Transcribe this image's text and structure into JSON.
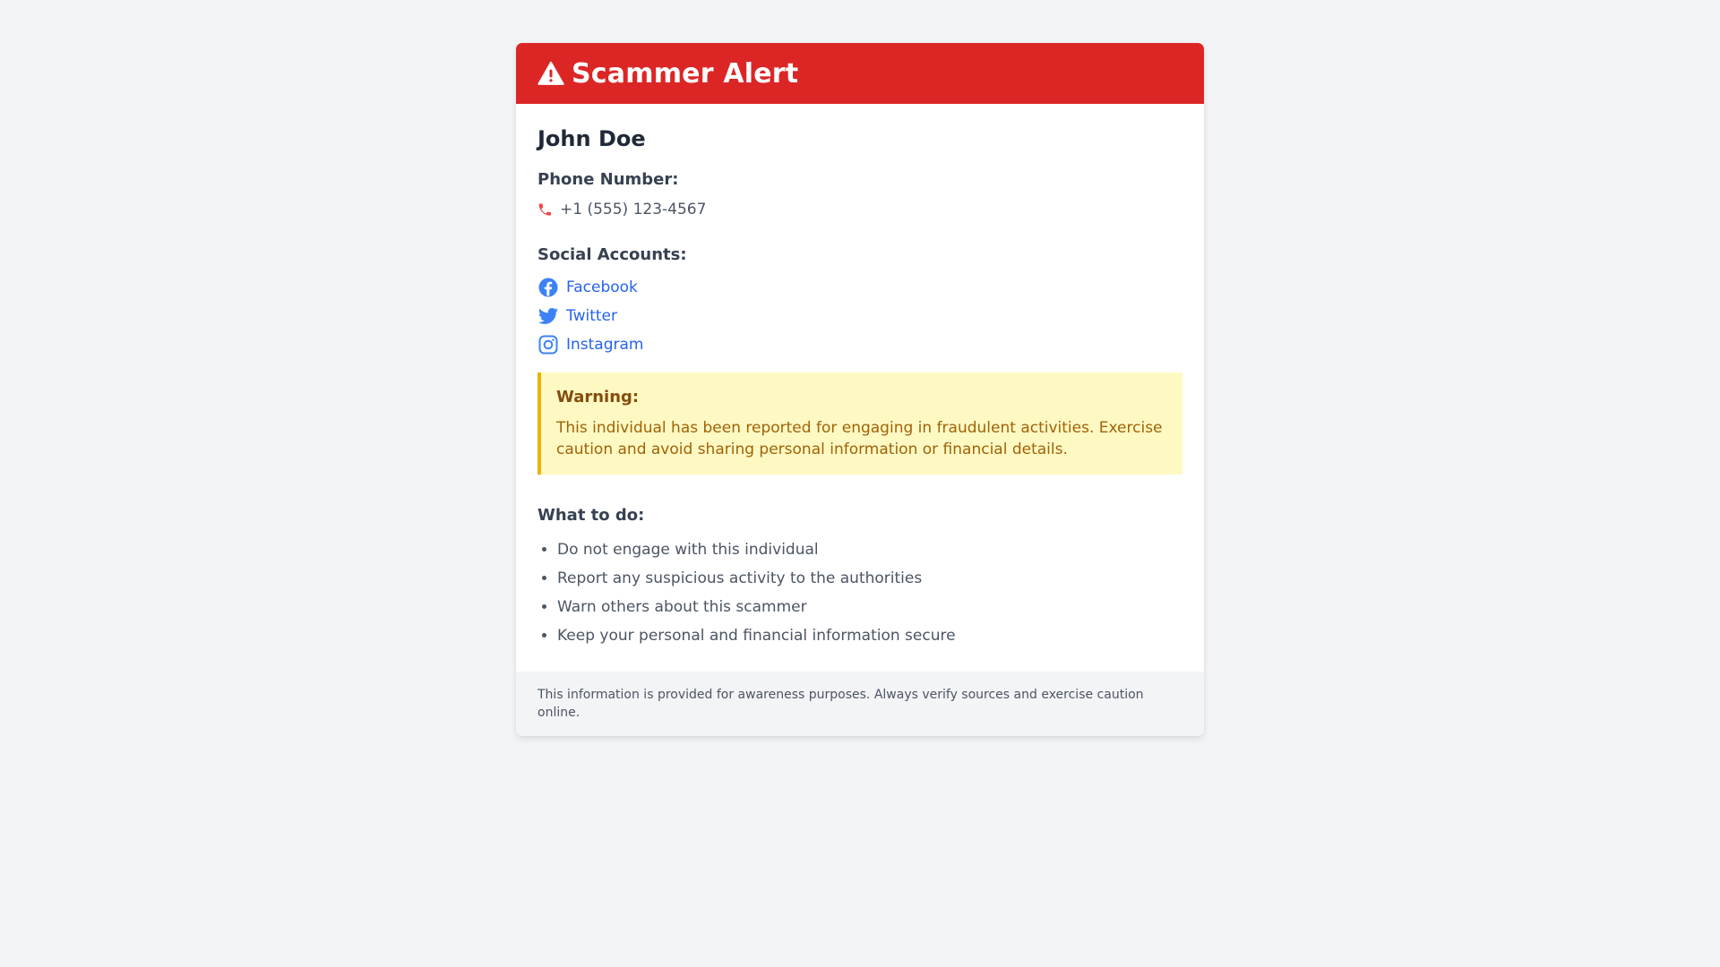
{
  "header": {
    "title": "Scammer Alert",
    "icon": "warning-triangle-icon",
    "background_color": "#dc2626"
  },
  "person": {
    "name": "John Doe"
  },
  "phone": {
    "label": "Phone Number:",
    "icon": "phone-icon",
    "number": "+1 (555) 123-4567"
  },
  "social": {
    "label": "Social Accounts:",
    "accounts": [
      {
        "name": "Facebook",
        "icon": "facebook-icon"
      },
      {
        "name": "Twitter",
        "icon": "twitter-icon"
      },
      {
        "name": "Instagram",
        "icon": "instagram-icon"
      }
    ],
    "link_color": "#2563eb"
  },
  "warning": {
    "title": "Warning:",
    "text": "This individual has been reported for engaging in fraudulent activities. Exercise caution and avoid sharing personal information or financial details.",
    "background_color": "#fef9c3",
    "border_color": "#eab308"
  },
  "todo": {
    "label": "What to do:",
    "items": [
      "Do not engage with this individual",
      "Report any suspicious activity to the authorities",
      "Warn others about this scammer",
      "Keep your personal and financial information secure"
    ]
  },
  "footer": {
    "text": "This information is provided for awareness purposes. Always verify sources and exercise caution online."
  }
}
